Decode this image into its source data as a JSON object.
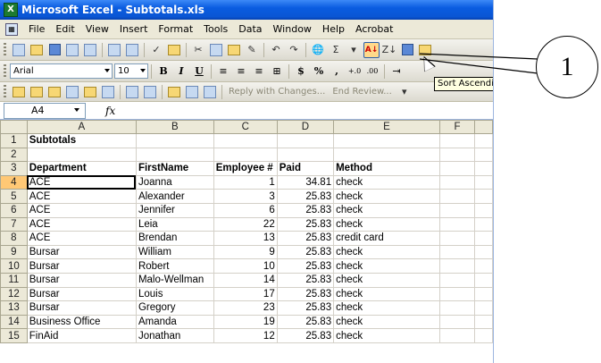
{
  "window": {
    "title": "Microsoft Excel - Subtotals.xls"
  },
  "menubar": {
    "items": [
      "File",
      "Edit",
      "View",
      "Insert",
      "Format",
      "Tools",
      "Data",
      "Window",
      "Help",
      "Acrobat"
    ]
  },
  "toolbar": {
    "font_name": "Arial",
    "font_size": "10",
    "bold": "B",
    "italic": "I",
    "underline": "U",
    "currency": "$",
    "percent": "%",
    "comma": ",",
    "sigma": "Σ",
    "sort_tooltip": "Sort Ascending"
  },
  "reviewbar": {
    "reply_label": "Reply with Changes...",
    "end_review_label": "End Review..."
  },
  "formula_bar": {
    "name_box": "A4",
    "fx": "fx",
    "value": ""
  },
  "sheet": {
    "columns": [
      "A",
      "B",
      "C",
      "D",
      "E",
      "F"
    ],
    "rows": [
      {
        "n": "1",
        "a": "Subtotals",
        "b": "",
        "c": "",
        "d": "",
        "e": ""
      },
      {
        "n": "2",
        "a": "",
        "b": "",
        "c": "",
        "d": "",
        "e": ""
      },
      {
        "n": "3",
        "a": "Department",
        "b": "FirstName",
        "c": "Employee #",
        "d": "Paid",
        "e": "Method"
      },
      {
        "n": "4",
        "a": "ACE",
        "b": "Joanna",
        "c": "1",
        "d": "34.81",
        "e": "check"
      },
      {
        "n": "5",
        "a": "ACE",
        "b": "Alexander",
        "c": "3",
        "d": "25.83",
        "e": "check"
      },
      {
        "n": "6",
        "a": "ACE",
        "b": "Jennifer",
        "c": "6",
        "d": "25.83",
        "e": "check"
      },
      {
        "n": "7",
        "a": "ACE",
        "b": "Leia",
        "c": "22",
        "d": "25.83",
        "e": "check"
      },
      {
        "n": "8",
        "a": "ACE",
        "b": "Brendan",
        "c": "13",
        "d": "25.83",
        "e": "credit card"
      },
      {
        "n": "9",
        "a": "Bursar",
        "b": "William",
        "c": "9",
        "d": "25.83",
        "e": "check"
      },
      {
        "n": "10",
        "a": "Bursar",
        "b": "Robert",
        "c": "10",
        "d": "25.83",
        "e": "check"
      },
      {
        "n": "11",
        "a": "Bursar",
        "b": "Malo-Wellman",
        "c": "14",
        "d": "25.83",
        "e": "check"
      },
      {
        "n": "12",
        "a": "Bursar",
        "b": "Louis",
        "c": "17",
        "d": "25.83",
        "e": "check"
      },
      {
        "n": "13",
        "a": "Bursar",
        "b": "Gregory",
        "c": "23",
        "d": "25.83",
        "e": "check"
      },
      {
        "n": "14",
        "a": "Business Office",
        "b": "Amanda",
        "c": "19",
        "d": "25.83",
        "e": "check"
      },
      {
        "n": "15",
        "a": "FinAid",
        "b": "Jonathan",
        "c": "12",
        "d": "25.83",
        "e": "check"
      }
    ]
  },
  "callout": {
    "label": "1"
  }
}
